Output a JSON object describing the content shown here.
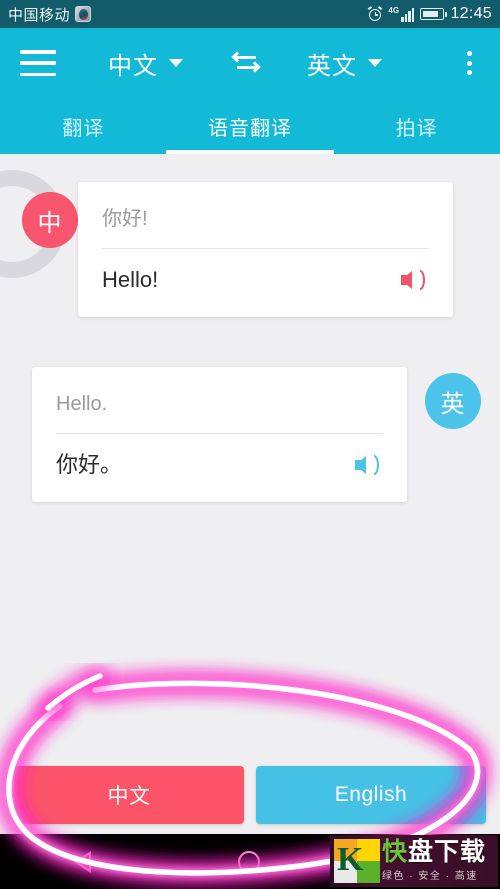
{
  "status_bar": {
    "carrier": "中国移动",
    "app_icon": "penguin-app-icon",
    "alarm_icon": "alarm-icon",
    "network": "4G",
    "signal_icon": "signal-bars-icon",
    "battery_icon": "battery-icon",
    "time": "12:45"
  },
  "app_bar": {
    "menu_icon": "hamburger-menu-icon",
    "source_language": "中文",
    "swap_icon": "swap-languages-icon",
    "target_language": "英文",
    "overflow_icon": "more-options-icon",
    "background_color": "#12bad8"
  },
  "tabs": [
    {
      "label": "翻译",
      "active": false
    },
    {
      "label": "语音翻译",
      "active": true
    },
    {
      "label": "拍译",
      "active": false
    }
  ],
  "conversation": [
    {
      "avatar": "中",
      "avatar_color": "#f8566e",
      "source_text": "你好!",
      "translated_text": "Hello!",
      "speaker_icon": "speaker-icon",
      "side": "left"
    },
    {
      "avatar": "英",
      "avatar_color": "#4cc3e8",
      "source_text": "Hello.",
      "translated_text": "你好。",
      "speaker_icon": "speaker-icon",
      "side": "right"
    }
  ],
  "bottom_buttons": [
    {
      "label": "中文",
      "color": "#fb5469"
    },
    {
      "label": "English",
      "color": "#46c1e6"
    }
  ],
  "nav_bar": {
    "back_icon": "back-triangle-icon",
    "home_icon": "home-circle-icon",
    "recents_icon": "recents-square-icon"
  },
  "annotation": {
    "shape": "pink-neon-ellipse-highlight",
    "color": "#ff3fd0"
  },
  "watermark": {
    "logo": "k-logo-icon",
    "text_green": "快",
    "text_white": "盘下载",
    "subtitle": "绿色 · 安全 · 高速"
  }
}
